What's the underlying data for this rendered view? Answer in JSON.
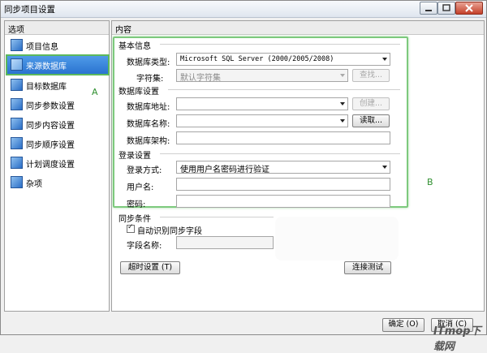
{
  "window": {
    "title": "同步项目设置"
  },
  "left_panel": {
    "header": "选项",
    "items": [
      {
        "label": "项目信息"
      },
      {
        "label": "来源数据库"
      },
      {
        "label": "目标数据库"
      },
      {
        "label": "同步参数设置"
      },
      {
        "label": "同步内容设置"
      },
      {
        "label": "同步顺序设置"
      },
      {
        "label": "计划调度设置"
      },
      {
        "label": "杂项"
      }
    ]
  },
  "content": {
    "header": "内容",
    "basic": {
      "title": "基本信息",
      "db_type_label": "数据库类型:",
      "db_type_value": "Microsoft SQL Server (2000/2005/2008)",
      "charset_label": "字符集:",
      "charset_value": "默认字符集",
      "find_button": "查找..."
    },
    "db_settings": {
      "title": "数据库设置",
      "address_label": "数据库地址:",
      "address_value": "",
      "create_button": "创建...",
      "name_label": "数据库名称:",
      "name_value": "",
      "read_button": "读取...",
      "schema_label": "数据库架构:",
      "schema_value": ""
    },
    "login": {
      "title": "登录设置",
      "method_label": "登录方式:",
      "method_value": "使用用户名密码进行验证",
      "user_label": "用户名:",
      "user_value": "",
      "password_label": "密码:",
      "password_value": ""
    },
    "sync": {
      "title": "同步条件",
      "auto_checkbox_label": "自动识别同步字段",
      "auto_checked": true,
      "field_name_label": "字段名称:",
      "field_name_value": ""
    },
    "timeout_button": "超时设置 (T)",
    "test_button": "连接测试"
  },
  "footer": {
    "ok_button": "确定 (O)",
    "cancel_button": "取消 (C)"
  },
  "annotations": {
    "a": "A",
    "b": "B"
  },
  "watermark": "ITmop下载网",
  "colors": {
    "highlight_box": "#7dc97d",
    "selection": "#2a73d0"
  }
}
